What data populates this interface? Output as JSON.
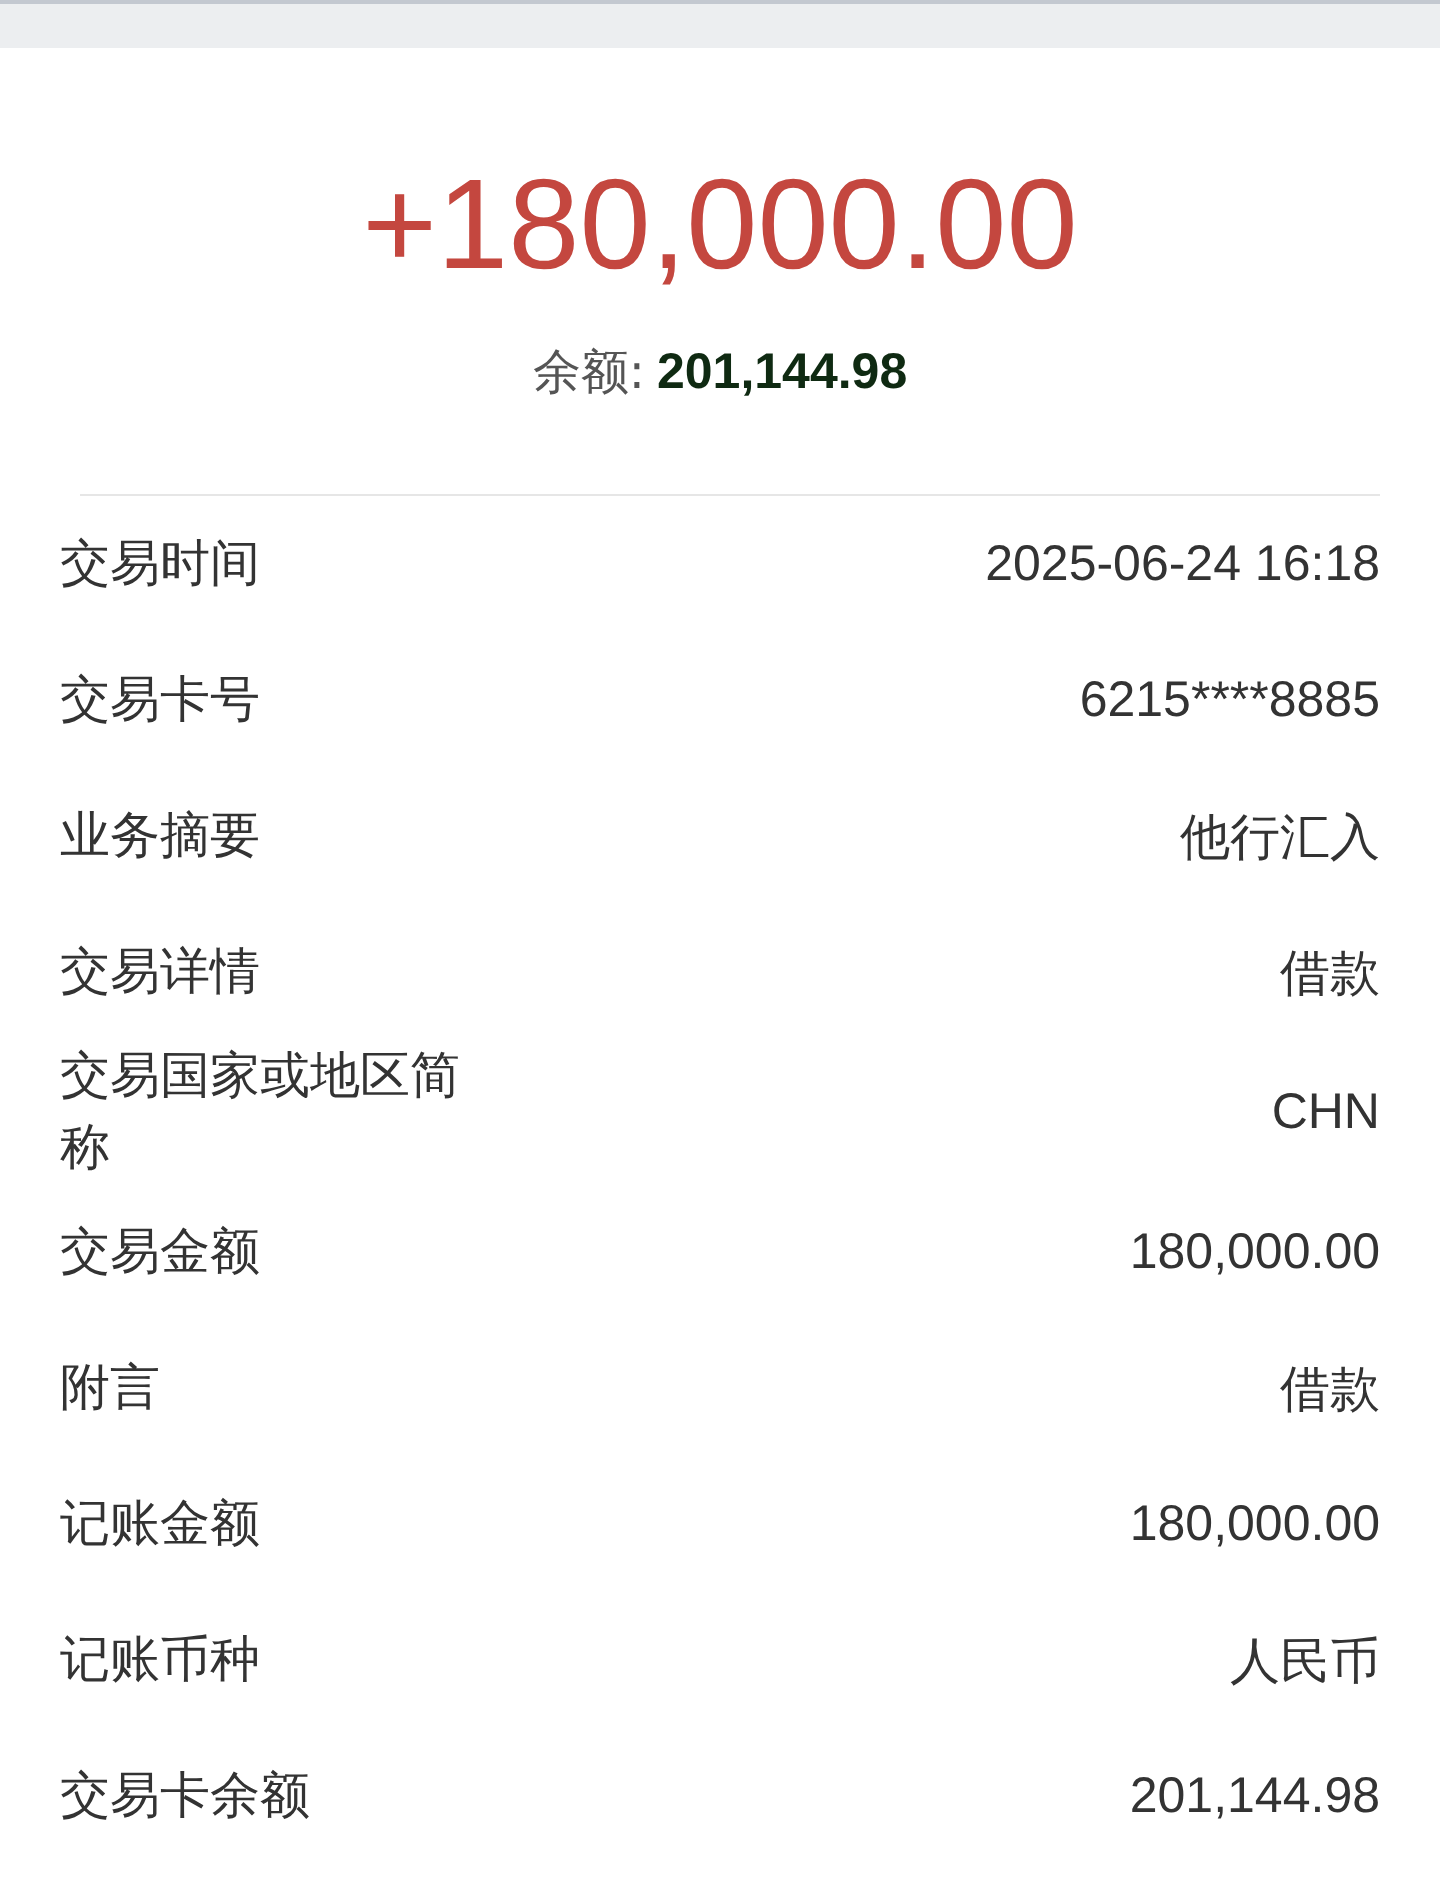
{
  "amount": "+180,000.00",
  "balance": {
    "label": "余额:",
    "value": "201,144.98"
  },
  "details": [
    {
      "label": "交易时间",
      "value": "2025-06-24 16:18"
    },
    {
      "label": "交易卡号",
      "value": "6215****8885"
    },
    {
      "label": "业务摘要",
      "value": "他行汇入"
    },
    {
      "label": "交易详情",
      "value": "借款"
    },
    {
      "label": "交易国家或地区简称",
      "value": "CHN"
    },
    {
      "label": "交易金额",
      "value": "180,000.00"
    },
    {
      "label": "附言",
      "value": "借款"
    },
    {
      "label": "记账金额",
      "value": "180,000.00"
    },
    {
      "label": "记账币种",
      "value": "人民币"
    },
    {
      "label": "交易卡余额",
      "value": "201,144.98"
    }
  ]
}
